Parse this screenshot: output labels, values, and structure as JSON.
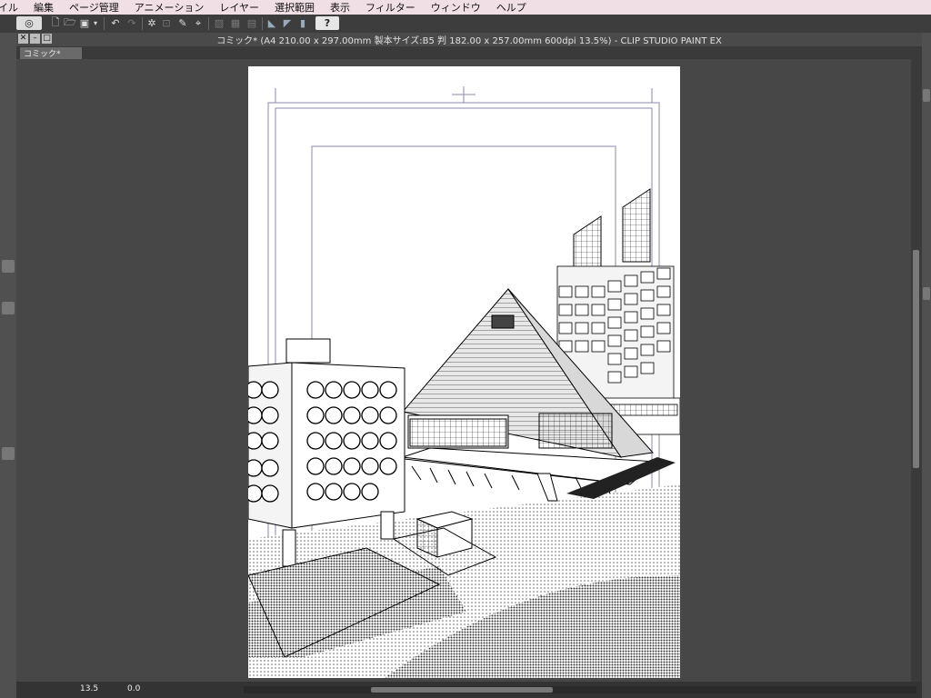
{
  "menu": [
    "イル",
    "編集",
    "ページ管理",
    "アニメーション",
    "レイヤー",
    "選択範囲",
    "表示",
    "フィルター",
    "ウィンドウ",
    "ヘルプ"
  ],
  "toolbar": {
    "help_label": "?"
  },
  "window": {
    "title": "コミック* (A4 210.00 x 297.00mm 製本サイズ:B5 判 182.00 x 257.00mm 600dpi 13.5%)  - CLIP STUDIO PAINT EX"
  },
  "tabs": [
    {
      "label": "コミック*"
    }
  ],
  "status": {
    "zoom": "13.5",
    "angle": "0.0"
  }
}
